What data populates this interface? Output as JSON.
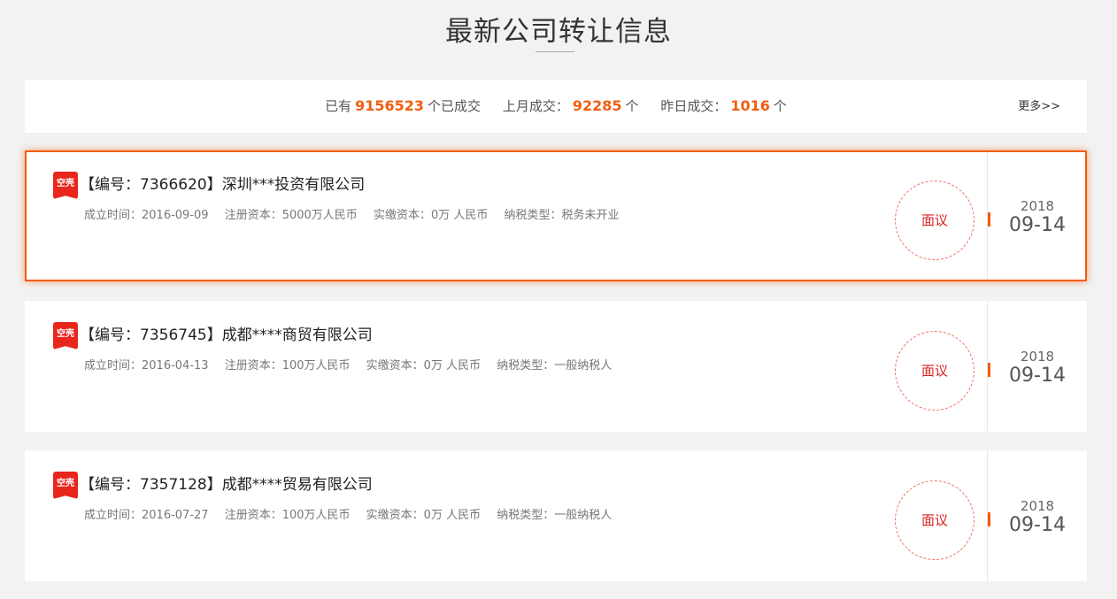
{
  "header": {
    "title": "最新公司转让信息"
  },
  "stats": {
    "prefix1": "已有",
    "total": "9156523",
    "suffix1": "个已成交",
    "prefix2": "上月成交：",
    "last_month": "92285",
    "suffix2": "个",
    "prefix3": "昨日成交：",
    "yesterday": "1016",
    "suffix3": "个",
    "more_label": "更多>>"
  },
  "listings": [
    {
      "badge": "空壳",
      "title": "【编号：7366620】深圳***投资有限公司",
      "established": "成立时间：2016-09-09",
      "registered_capital": "注册资本：5000万人民币",
      "paid_capital": "实缴资本：0万 人民币",
      "tax_type": "纳税类型：税务未开业",
      "price": "面议",
      "year": "2018",
      "date": "09-14"
    },
    {
      "badge": "空壳",
      "title": "【编号：7356745】成都****商贸有限公司",
      "established": "成立时间：2016-04-13",
      "registered_capital": "注册资本：100万人民币",
      "paid_capital": "实缴资本：0万 人民币",
      "tax_type": "纳税类型：一般纳税人",
      "price": "面议",
      "year": "2018",
      "date": "09-14"
    },
    {
      "badge": "空壳",
      "title": "【编号：7357128】成都****贸易有限公司",
      "established": "成立时间：2016-07-27",
      "registered_capital": "注册资本：100万人民币",
      "paid_capital": "实缴资本：0万 人民币",
      "tax_type": "纳税类型：一般纳税人",
      "price": "面议",
      "year": "2018",
      "date": "09-14"
    }
  ],
  "colors": {
    "accent": "#f25d0e",
    "badge": "#e8261c",
    "price": "#dd2222"
  }
}
